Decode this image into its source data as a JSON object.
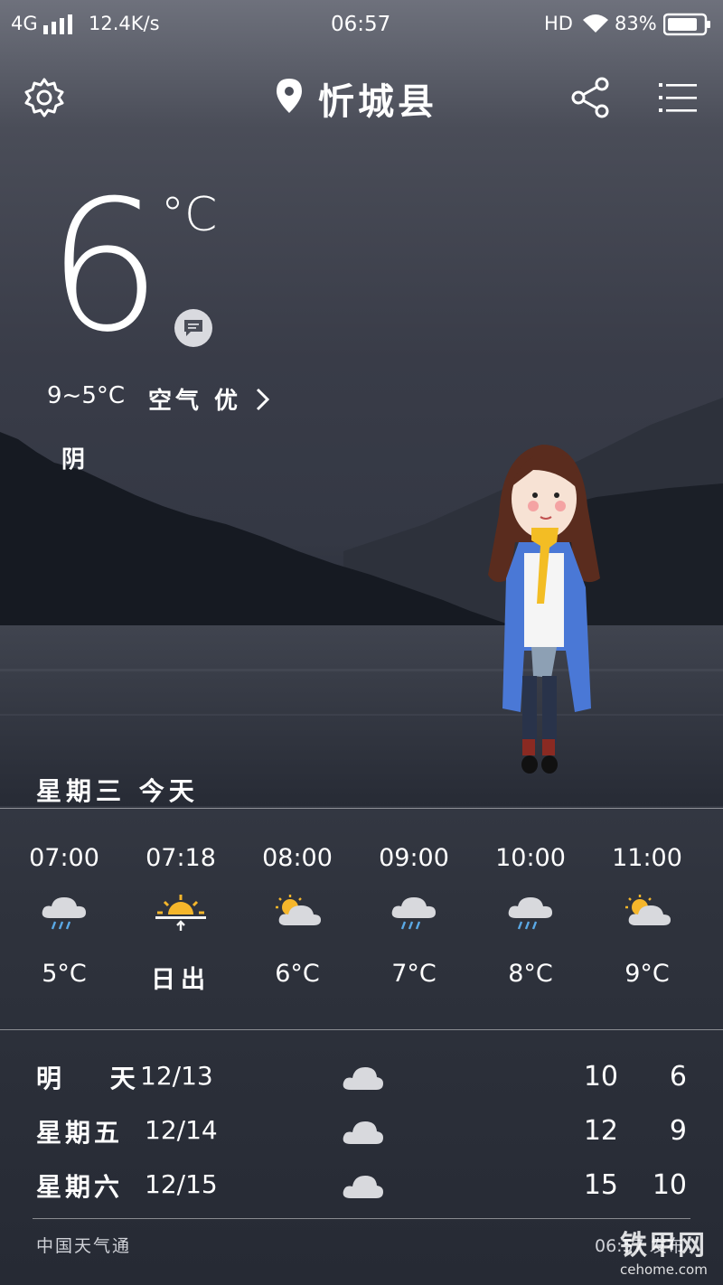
{
  "status_bar": {
    "network": "4G",
    "speed": "12.4K/s",
    "time": "06:57",
    "hd": "HD",
    "battery": "83%"
  },
  "header": {
    "city": "忻城县",
    "icons": [
      "settings-icon",
      "location-pin-icon",
      "share-icon",
      "menu-icon"
    ]
  },
  "current": {
    "temperature": "6",
    "unit": "°C",
    "range": "9~5°C",
    "air_quality": "空气 优",
    "condition": "阴"
  },
  "today_label": "星期三  今天",
  "hourly": [
    {
      "time": "07:00",
      "icon": "rain-icon",
      "value": "5°C"
    },
    {
      "time": "07:18",
      "icon": "sunrise-icon",
      "value": "日出"
    },
    {
      "time": "08:00",
      "icon": "partly-cloudy-icon",
      "value": "6°C"
    },
    {
      "time": "09:00",
      "icon": "rain-icon",
      "value": "7°C"
    },
    {
      "time": "10:00",
      "icon": "rain-icon",
      "value": "8°C"
    },
    {
      "time": "11:00",
      "icon": "partly-cloudy-icon",
      "value": "9°C"
    }
  ],
  "daily": [
    {
      "day": "明 天",
      "date": "12/13",
      "icon": "cloud-icon",
      "high": "10",
      "low": "6"
    },
    {
      "day": "星期五",
      "date": "12/14",
      "icon": "cloud-icon",
      "high": "12",
      "low": "9"
    },
    {
      "day": "星期六",
      "date": "12/15",
      "icon": "cloud-icon",
      "high": "15",
      "low": "10"
    }
  ],
  "footer": {
    "source": "中国天气通",
    "updated": "06:57 发布"
  },
  "watermark": {
    "line1": "铁甲网",
    "line2": "cehome.com"
  },
  "colors": {
    "sun": "#f5b62b",
    "cloud": "#d8d9dd",
    "rain": "#5aa9e6",
    "coat": "#4a78d6",
    "scarf": "#f3bd24"
  }
}
